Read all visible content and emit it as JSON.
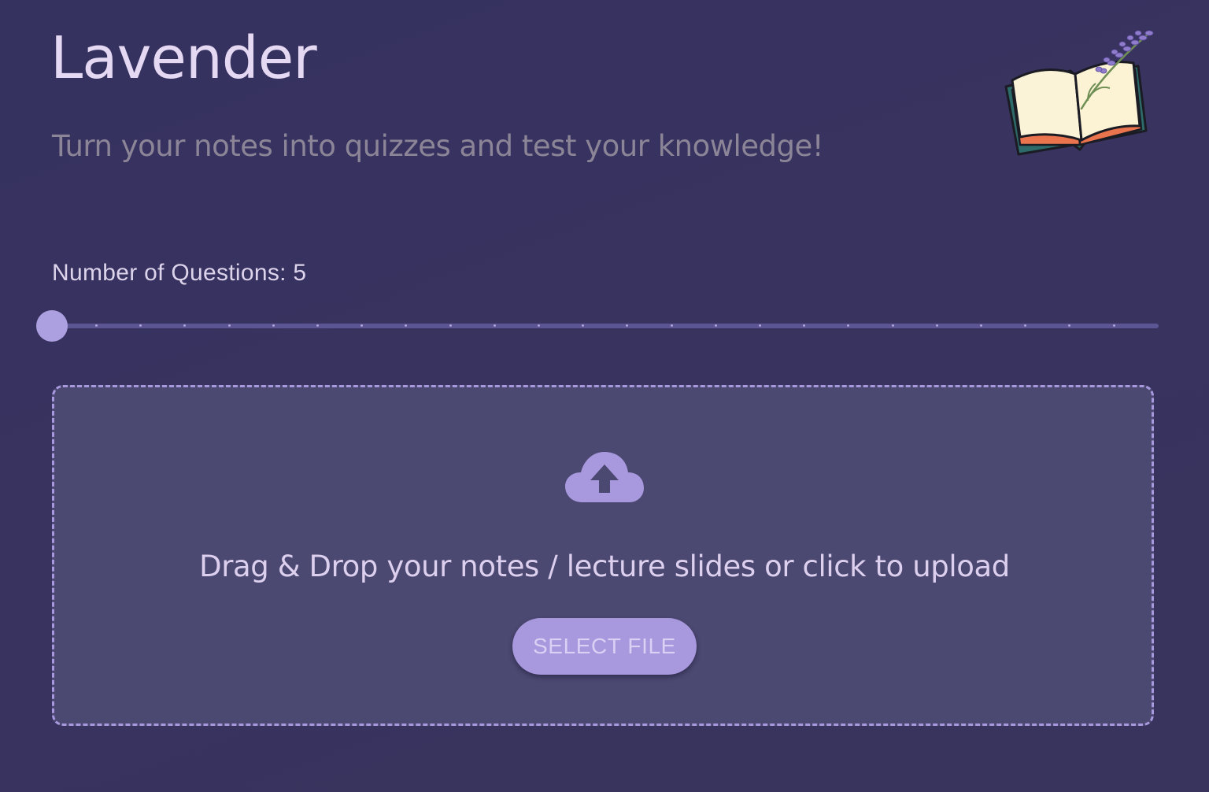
{
  "header": {
    "title": "Lavender",
    "subtitle": "Turn your notes into quizzes and test your knowledge!",
    "logo_icon": "open-book-with-lavender-icon"
  },
  "question_count": {
    "label": "Number of Questions: 5",
    "value": 5,
    "tick_count": 26
  },
  "upload": {
    "icon": "cloud-upload-icon",
    "prompt": "Drag & Drop your notes / lecture slides or click to upload",
    "button_label": "SELECT FILE"
  },
  "colors": {
    "background": "#37325f",
    "title": "#e4d8f2",
    "subtitle": "#8c8597",
    "accent": "#a898de",
    "dropzone_fill": "#4b4871",
    "dropzone_border": "#a899df"
  }
}
